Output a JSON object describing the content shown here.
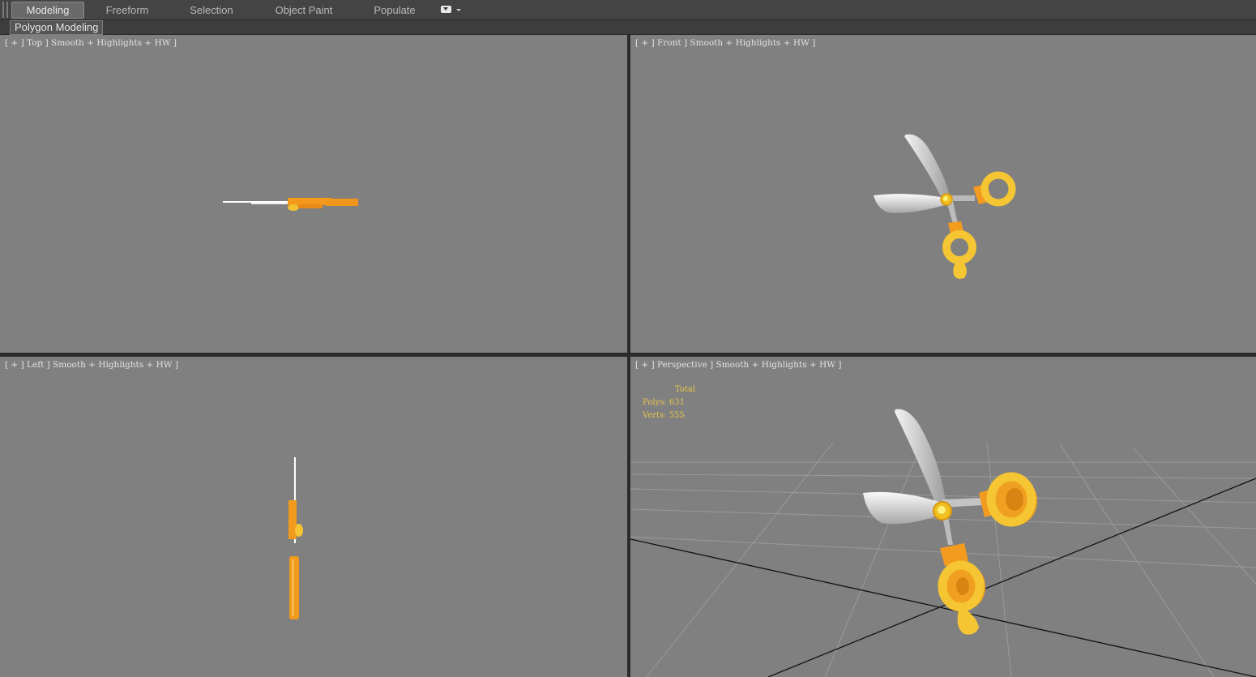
{
  "ribbon": {
    "tabs": [
      {
        "label": "Modeling",
        "active": true
      },
      {
        "label": "Freeform"
      },
      {
        "label": "Selection"
      },
      {
        "label": "Object Paint"
      },
      {
        "label": "Populate"
      }
    ],
    "sub_button": "Polygon Modeling"
  },
  "viewports": {
    "top": "[ + ] Top ] Smooth + Highlights + HW ]",
    "front": "[ + ] Front ] Smooth + Highlights + HW ]",
    "left": "[ + ] Left ] Smooth + Highlights + HW ]",
    "perspective": "[ + ] Perspective ] Smooth + Highlights + HW ]"
  },
  "stats": {
    "header": "Total",
    "polys": "Polys: 631",
    "verts": "Verts: 555"
  },
  "colors": {
    "viewport_bg": "#808080",
    "accent_orange": "#f0a020",
    "accent_yellow": "#f3c633",
    "stats_text": "#e8c64a"
  }
}
